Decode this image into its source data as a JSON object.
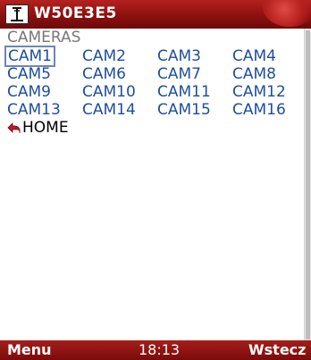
{
  "title_bar": {
    "title": "W50E3E5",
    "icon": "antenna-icon"
  },
  "section": {
    "label": "CAMERAS"
  },
  "cameras": [
    "CAM1",
    "CAM2",
    "CAM3",
    "CAM4",
    "CAM5",
    "CAM6",
    "CAM7",
    "CAM8",
    "CAM9",
    "CAM10",
    "CAM11",
    "CAM12",
    "CAM13",
    "CAM14",
    "CAM15",
    "CAM16"
  ],
  "selected_camera": "CAM1",
  "home": {
    "label": "HOME",
    "icon": "back-arrow-icon"
  },
  "softkeys": {
    "left": "Menu",
    "clock": "18:13",
    "right": "Wstecz"
  },
  "colors": {
    "bar_red": "#8c100f",
    "link_blue": "#1d4e9c",
    "label_gray": "#777777"
  }
}
